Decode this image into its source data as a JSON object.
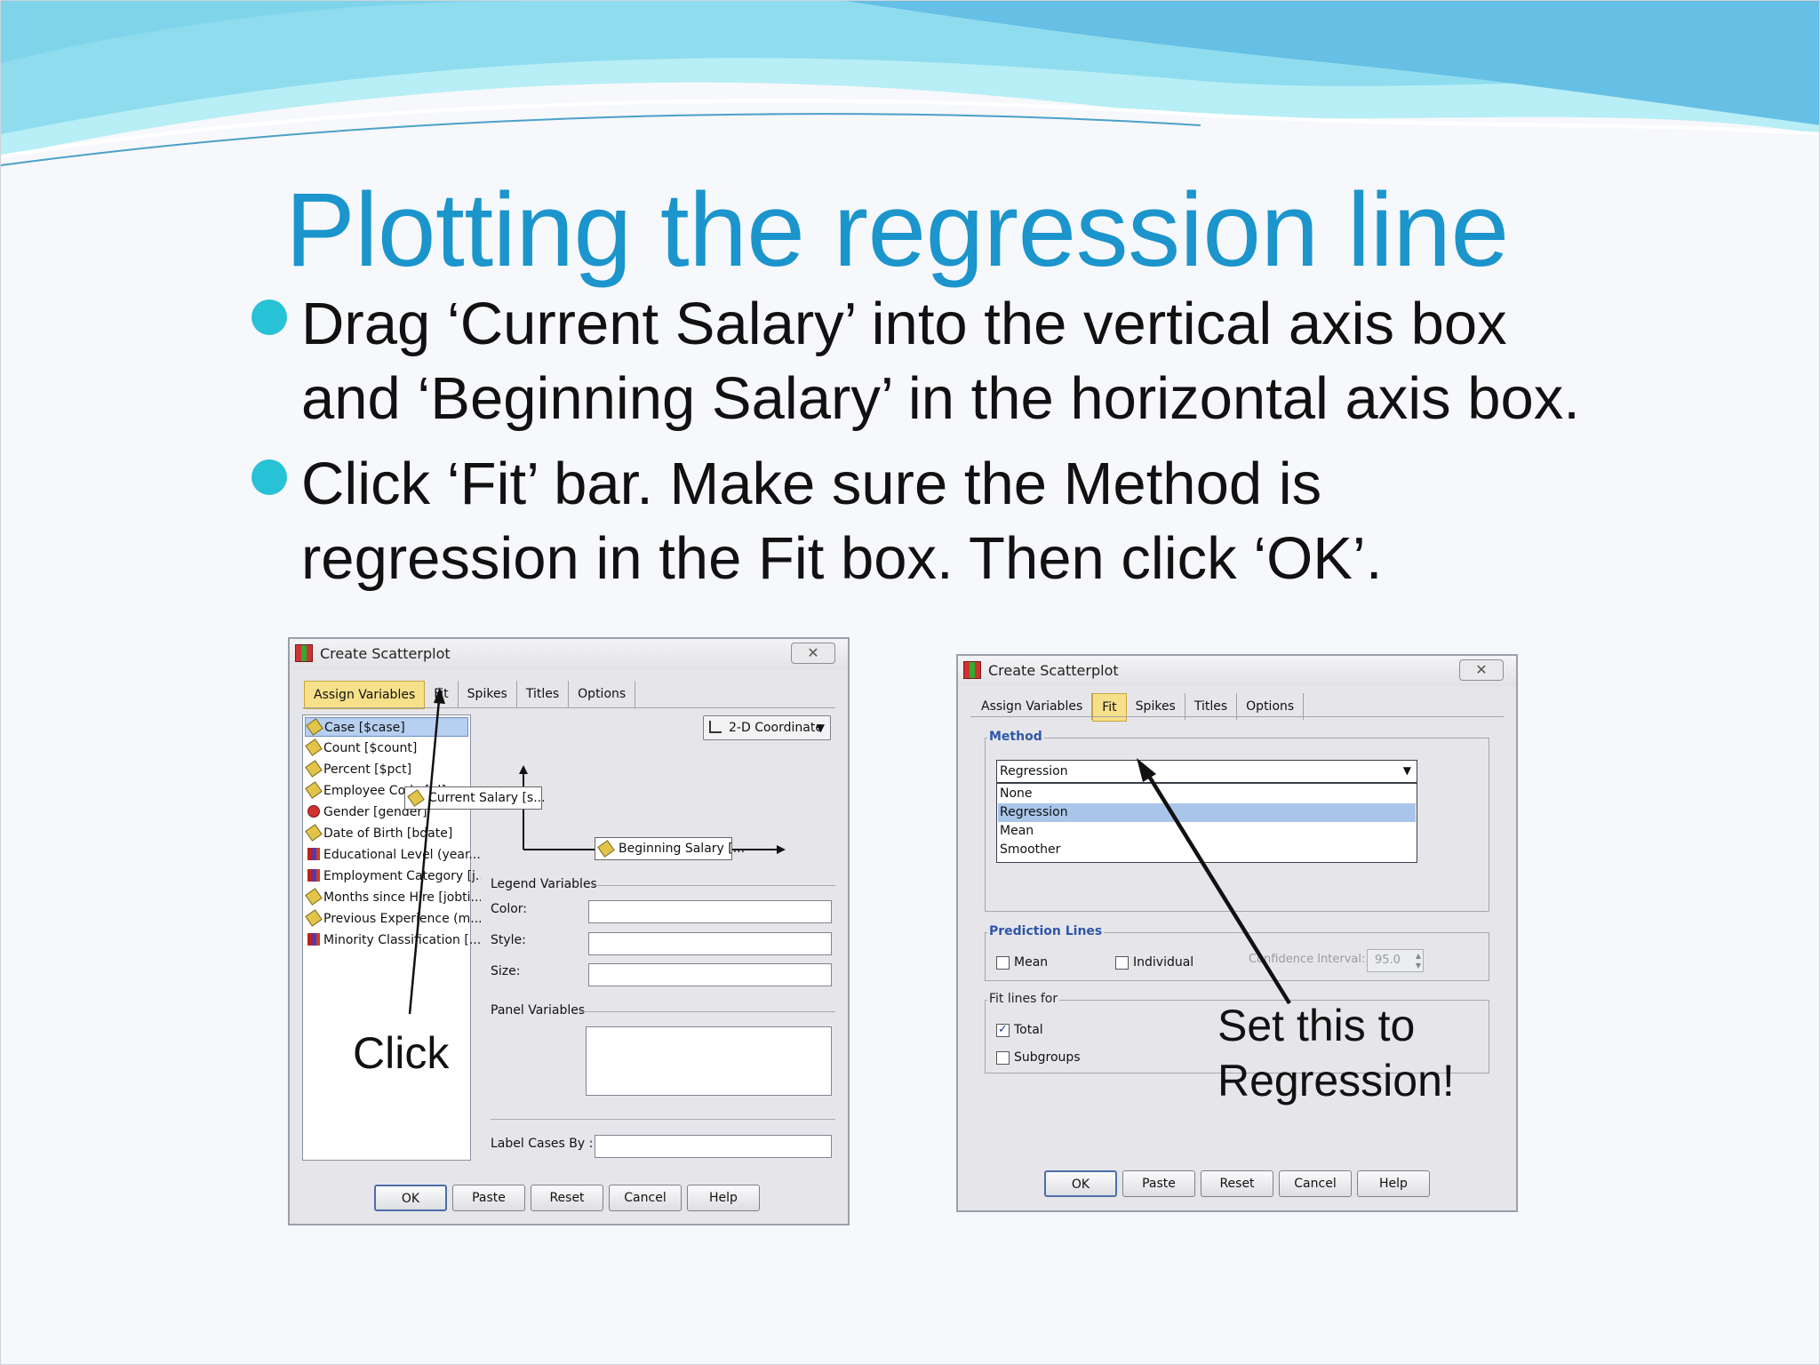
{
  "slide": {
    "title": "Plotting the regression line",
    "bullets": [
      {
        "lines": [
          "Drag ‘Current Salary’ into the vertical axis box",
          "and ‘Beginning Salary’ in the  horizontal axis box."
        ]
      },
      {
        "lines": [
          "Click ‘Fit’ bar.  Make sure the Method is",
          "regression in the Fit box. Then click ‘OK’."
        ]
      }
    ],
    "colors": {
      "title": "#1b95cc",
      "bullet": "#27c2d6",
      "wave_light": "#9fe6f2",
      "wave_dark": "#5ab6de"
    }
  },
  "dialog_left": {
    "title": "Create Scatterplot",
    "close": "✕",
    "tabs": [
      "Assign Variables",
      "Fit",
      "Spikes",
      "Titles",
      "Options"
    ],
    "active_tab": "Assign Variables",
    "variables": [
      {
        "label": "Case [$case]",
        "icon": "scale-icon"
      },
      {
        "label": "Count [$count]",
        "icon": "scale-icon"
      },
      {
        "label": "Percent [$pct]",
        "icon": "scale-icon"
      },
      {
        "label": "Employee Code [id]",
        "icon": "scale-icon"
      },
      {
        "label": "Gender [gender]",
        "icon": "nominal-icon"
      },
      {
        "label": "Date of Birth [bdate]",
        "icon": "scale-icon"
      },
      {
        "label": "Educational Level (year...",
        "icon": "ordinal-icon"
      },
      {
        "label": "Employment Category [j...",
        "icon": "ordinal-icon"
      },
      {
        "label": "Months since Hire [jobti...",
        "icon": "scale-icon"
      },
      {
        "label": "Previous Experience (m...",
        "icon": "scale-icon"
      },
      {
        "label": "Minority Classification [...",
        "icon": "ordinal-icon"
      }
    ],
    "coordinate": "2-D Coordinate",
    "y_axis_var": "Current Salary [s...",
    "x_axis_var": "Beginning Salary [...",
    "legend_variables": "Legend Variables",
    "color_label": "Color:",
    "style_label": "Style:",
    "size_label": "Size:",
    "panel_variables": "Panel Variables",
    "label_cases": "Label Cases By :",
    "buttons": [
      "OK",
      "Paste",
      "Reset",
      "Cancel",
      "Help"
    ],
    "annotation": "Click"
  },
  "dialog_right": {
    "title": "Create Scatterplot",
    "close": "✕",
    "tabs": [
      "Assign Variables",
      "Fit",
      "Spikes",
      "Titles",
      "Options"
    ],
    "active_tab": "Fit",
    "method_label": "Method",
    "method_value": "Regression",
    "method_options": [
      "None",
      "Regression",
      "Mean",
      "Smoother"
    ],
    "method_selected": "Regression",
    "prediction_lines": "Prediction Lines",
    "mean_label": "Mean",
    "individual_label": "Individual",
    "confidence_label": "Confidence Interval:",
    "confidence_value": "95.0",
    "fit_lines_for": "Fit lines for",
    "total_label": "Total",
    "total_checked": true,
    "subgroups_label": "Subgroups",
    "buttons": [
      "OK",
      "Paste",
      "Reset",
      "Cancel",
      "Help"
    ],
    "annotation": [
      "Set this to",
      "Regression!"
    ]
  }
}
